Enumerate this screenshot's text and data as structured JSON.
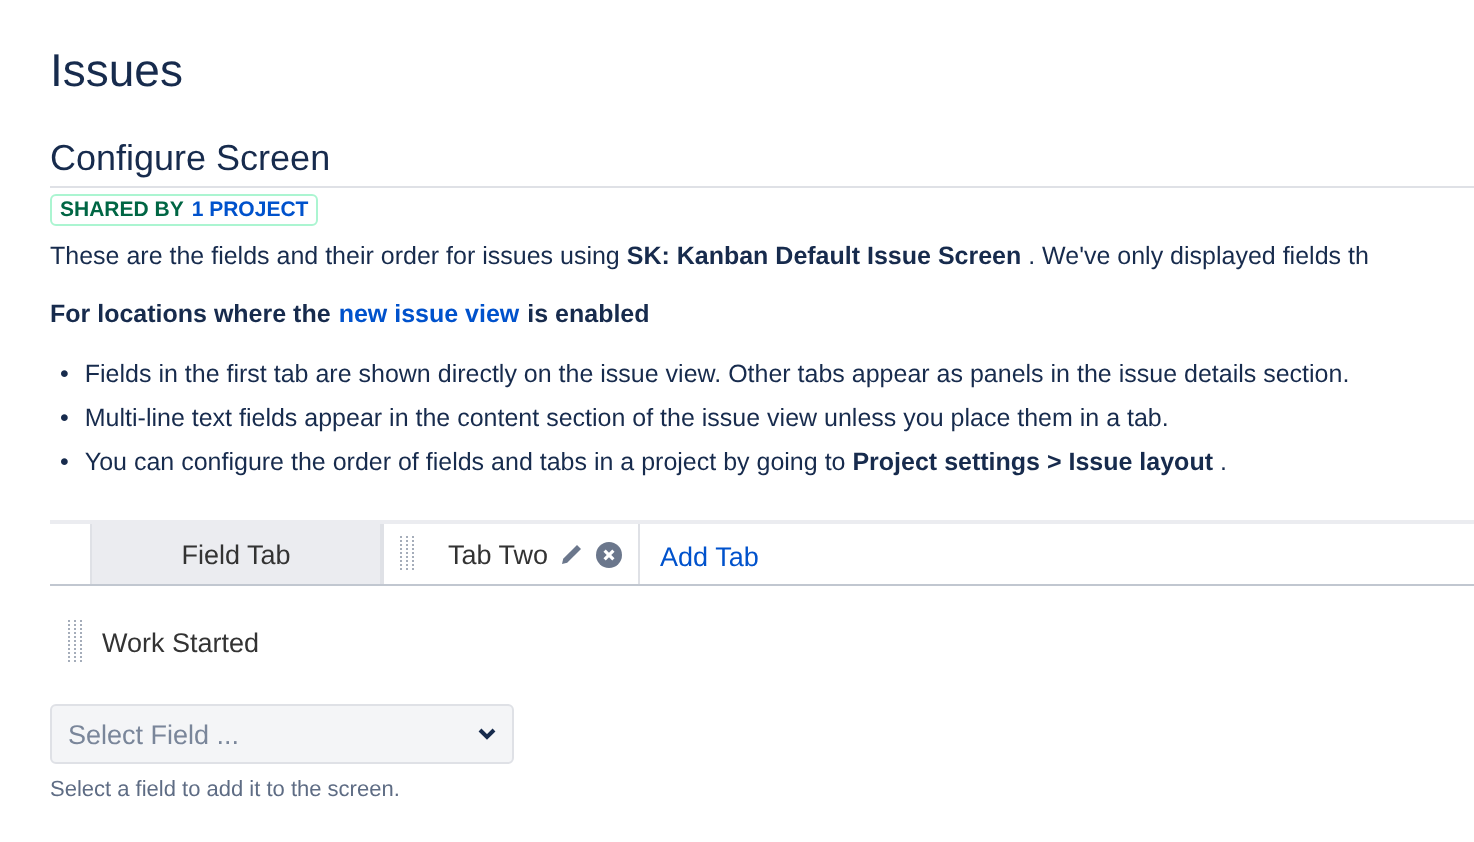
{
  "page_title": "Issues",
  "section_title": "Configure Screen",
  "badge": {
    "prefix": "SHARED BY",
    "link": "1 PROJECT"
  },
  "description": "These are the fields and their order for issues using **SK: Kanban Default Issue Screen** . We've only displayed fields th",
  "notice": {
    "before": "For locations where the",
    "link": "new issue view",
    "after": "is enabled"
  },
  "bullets": [
    {
      "marker": "•",
      "text": "Fields in the first tab are shown directly on the issue view. Other tabs appear as panels in the issue details section."
    },
    {
      "marker": "•",
      "text": "Multi-line text fields appear in the content section of the issue view unless you place them in a tab."
    },
    {
      "marker": "•",
      "text": "You can configure the order of fields and tabs in a project by going to **Project settings > Issue layout** ."
    }
  ],
  "tabs": [
    {
      "label": "Field Tab",
      "selected": false
    },
    {
      "label": "Tab Two",
      "selected": true
    }
  ],
  "add_tab": "Add Tab",
  "fields": [
    "Work Started"
  ],
  "select": {
    "placeholder": "Select Field ..."
  },
  "help": "Select a field to add it to the screen."
}
